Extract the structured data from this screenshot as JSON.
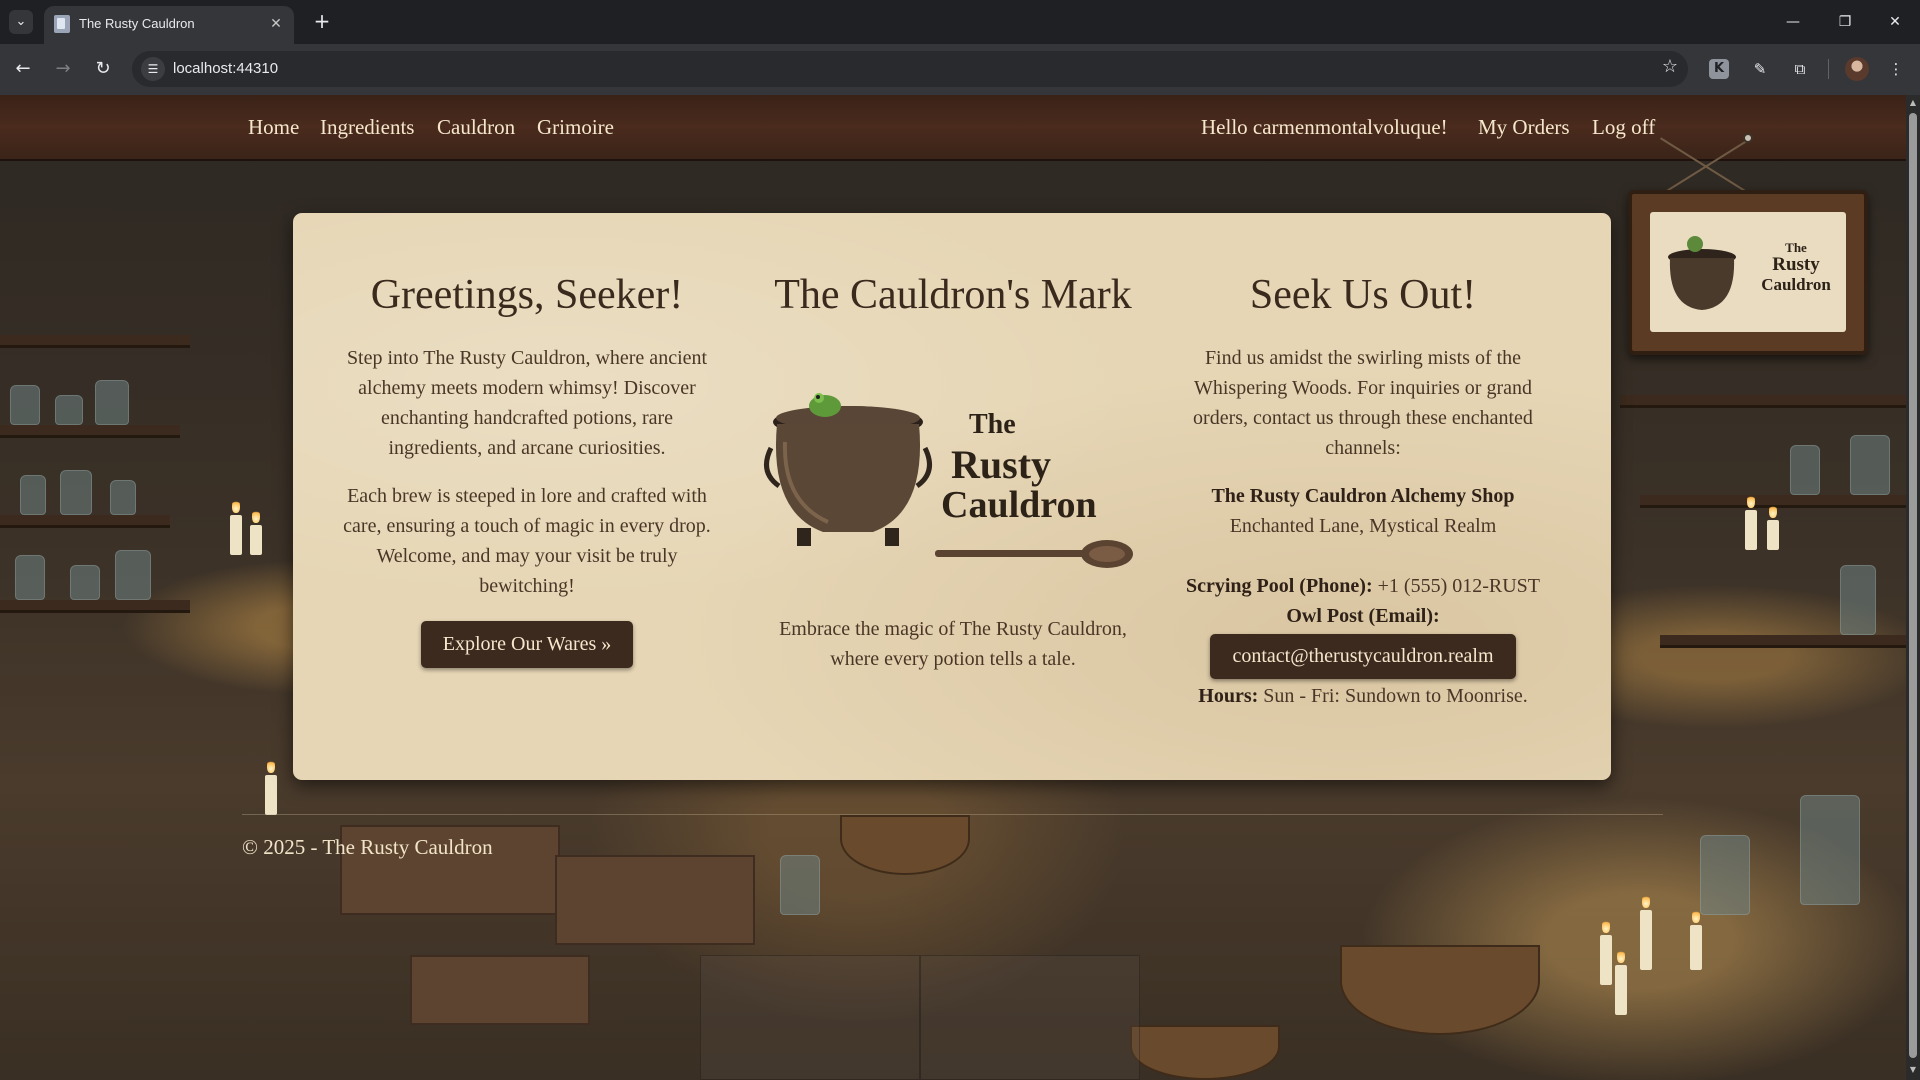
{
  "browser": {
    "tab_title": "The Rusty Cauldron",
    "url": "localhost:44310"
  },
  "nav": {
    "home": "Home",
    "ingredients": "Ingredients",
    "cauldron": "Cauldron",
    "grimoire": "Grimoire",
    "greeting": "Hello carmenmontalvoluque!",
    "my_orders": "My Orders",
    "log_off": "Log off"
  },
  "greetings": {
    "heading": "Greetings, Seeker!",
    "para1": "Step into The Rusty Cauldron, where ancient alchemy meets modern whimsy! Discover enchanting handcrafted potions, rare ingredients, and arcane curiosities.",
    "para2": "Each brew is steeped in lore and crafted with care, ensuring a touch of magic in every drop. Welcome, and may your visit be truly bewitching!",
    "button": "Explore Our Wares »"
  },
  "mark": {
    "heading": "The Cauldron's Mark",
    "logo_text_line1": "The",
    "logo_text_line2": "Rusty",
    "logo_text_line3": "Cauldron",
    "caption": "Embrace the magic of The Rusty Cauldron, where every potion tells a tale."
  },
  "contact": {
    "heading": "Seek Us Out!",
    "intro": "Find us amidst the swirling mists of the Whispering Woods. For inquiries or grand orders, contact us through these enchanted channels:",
    "shop_name": "The Rusty Cauldron Alchemy Shop",
    "address": "Enchanted Lane, Mystical Realm",
    "phone_label": "Scrying Pool (Phone):",
    "phone_value": "+1 (555) 012-RUST",
    "email_label": "Owl Post (Email):",
    "email_button": "contact@therustycauldron.realm",
    "hours_label": "Hours:",
    "hours_value": "Sun - Fri: Sundown to Moonrise."
  },
  "sign": {
    "line1": "The",
    "line2": "Rusty",
    "line3": "Cauldron"
  },
  "footer": {
    "text": "© 2025 - The Rusty Cauldron"
  },
  "colors": {
    "navbar": "#4a2b1d",
    "parchment": "#e6d6b5",
    "button": "#3d2a1f",
    "text_light": "#f5e7cc",
    "text_dark": "#3a2a1e"
  }
}
